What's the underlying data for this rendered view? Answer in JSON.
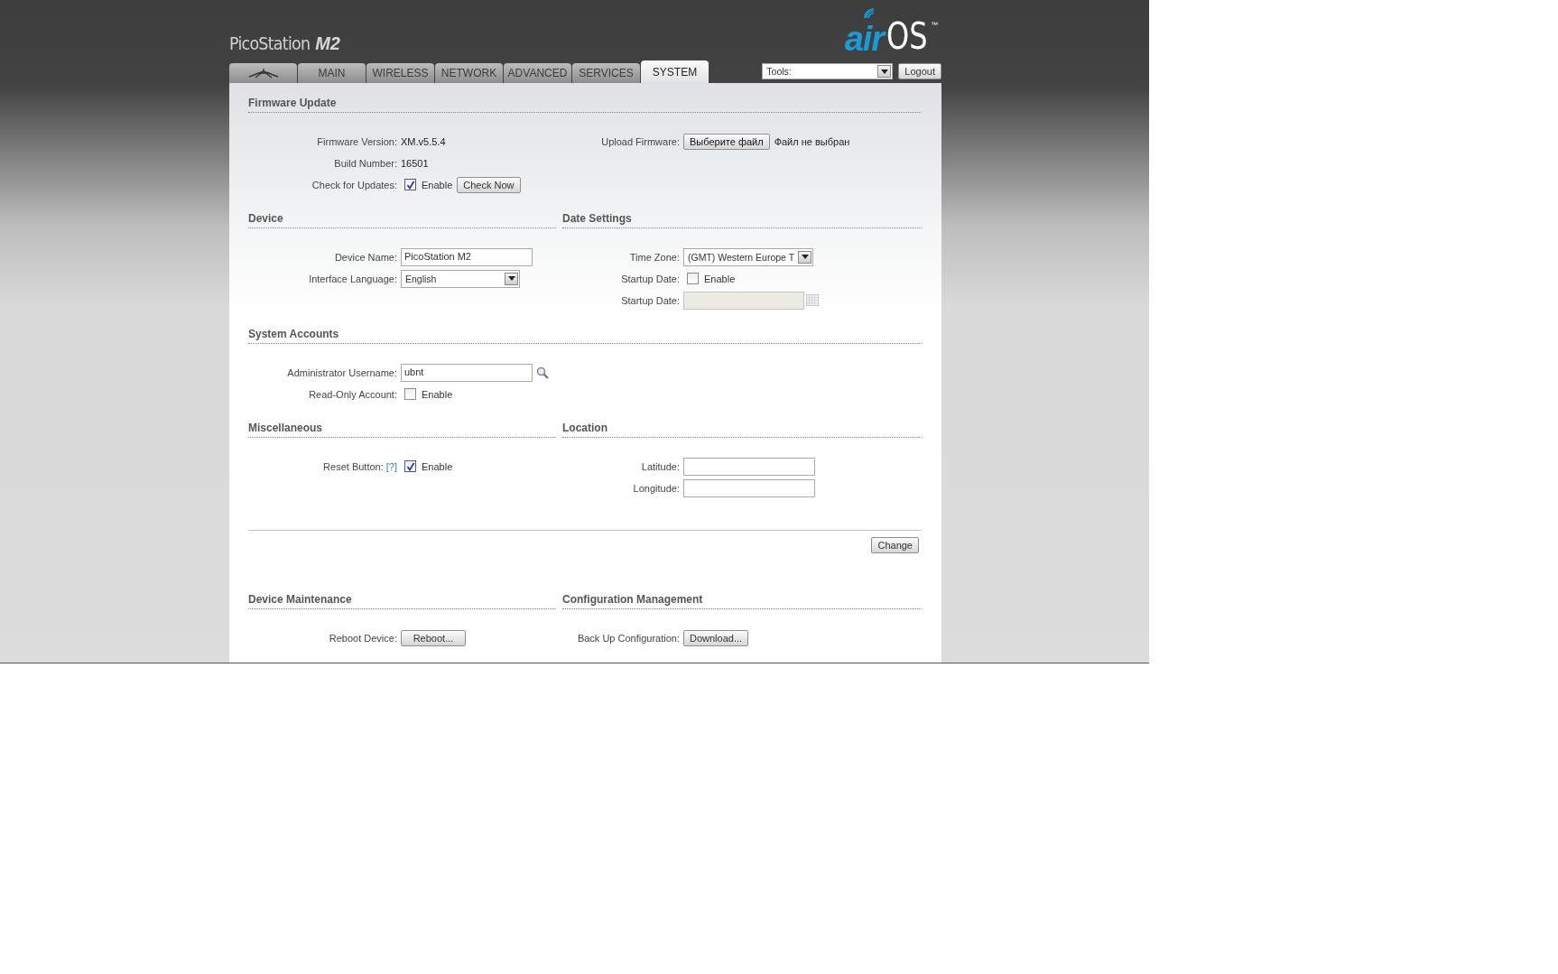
{
  "header": {
    "product": "PicoStation",
    "model": "M2",
    "logo_air": "air",
    "logo_os": "OS",
    "logo_tm": "™"
  },
  "tabs": [
    {
      "kind": "icon",
      "selected": false
    },
    {
      "kind": "text",
      "label": "MAIN",
      "selected": false
    },
    {
      "kind": "text",
      "label": "WIRELESS",
      "selected": false
    },
    {
      "kind": "text",
      "label": "NETWORK",
      "selected": false
    },
    {
      "kind": "text",
      "label": "ADVANCED",
      "selected": false
    },
    {
      "kind": "text",
      "label": "SERVICES",
      "selected": false
    },
    {
      "kind": "text",
      "label": "SYSTEM",
      "selected": true
    }
  ],
  "tools": {
    "value": "Tools:"
  },
  "logout": "Logout",
  "blocks": [
    {
      "kind": "full",
      "title": "Firmware Update",
      "columns": [
        [
          {
            "kind": "text",
            "label": "Firmware Version:",
            "value": "XM.v5.5.4"
          },
          {
            "kind": "text",
            "label": "Build Number:",
            "value": "16501"
          },
          {
            "kind": "checkbox",
            "label": "Check for Updates:",
            "checked": true,
            "text": "Enable",
            "button": "Check Now"
          }
        ],
        [
          {
            "kind": "file",
            "label": "Upload Firmware:",
            "button": "Выберите файл",
            "note": "Файл не выбран"
          }
        ]
      ]
    },
    {
      "kind": "pair",
      "sections": [
        {
          "title": "Device",
          "rows": [
            {
              "kind": "input",
              "label": "Device Name:",
              "value": "PicoStation M2"
            },
            {
              "kind": "select",
              "label": "Interface Language:",
              "value": "English"
            }
          ]
        },
        {
          "title": "Date Settings",
          "rows": [
            {
              "kind": "select",
              "label": "Time Zone:",
              "value": "(GMT) Western Europe T"
            },
            {
              "kind": "checkbox",
              "label": "Startup Date:",
              "checked": false,
              "text": "Enable"
            },
            {
              "kind": "date",
              "label": "Startup Date:",
              "disabled": true
            }
          ]
        }
      ]
    },
    {
      "kind": "full",
      "title": "System Accounts",
      "columns": [
        [
          {
            "kind": "search",
            "label": "Administrator Username:",
            "value": "ubnt"
          },
          {
            "kind": "checkbox",
            "label": "Read-Only Account:",
            "checked": false,
            "text": "Enable"
          }
        ]
      ]
    },
    {
      "kind": "pair",
      "sections": [
        {
          "title": "Miscellaneous",
          "rows": [
            {
              "kind": "checkbox",
              "label": "Reset Button:",
              "help": "[?]",
              "checked": true,
              "text": "Enable"
            }
          ]
        },
        {
          "title": "Location",
          "rows": [
            {
              "kind": "input",
              "label": "Latitude:"
            },
            {
              "kind": "input",
              "label": "Longitude:"
            }
          ]
        }
      ]
    },
    {
      "kind": "action",
      "button": "Change"
    },
    {
      "kind": "pair",
      "sections": [
        {
          "title": "Device Maintenance",
          "rows": [
            {
              "kind": "button",
              "label": "Reboot Device:",
              "button": "Reboot..."
            }
          ]
        },
        {
          "title": "Configuration Management",
          "rows": [
            {
              "kind": "button",
              "label": "Back Up Configuration:",
              "button": "Download..."
            }
          ]
        }
      ]
    }
  ]
}
